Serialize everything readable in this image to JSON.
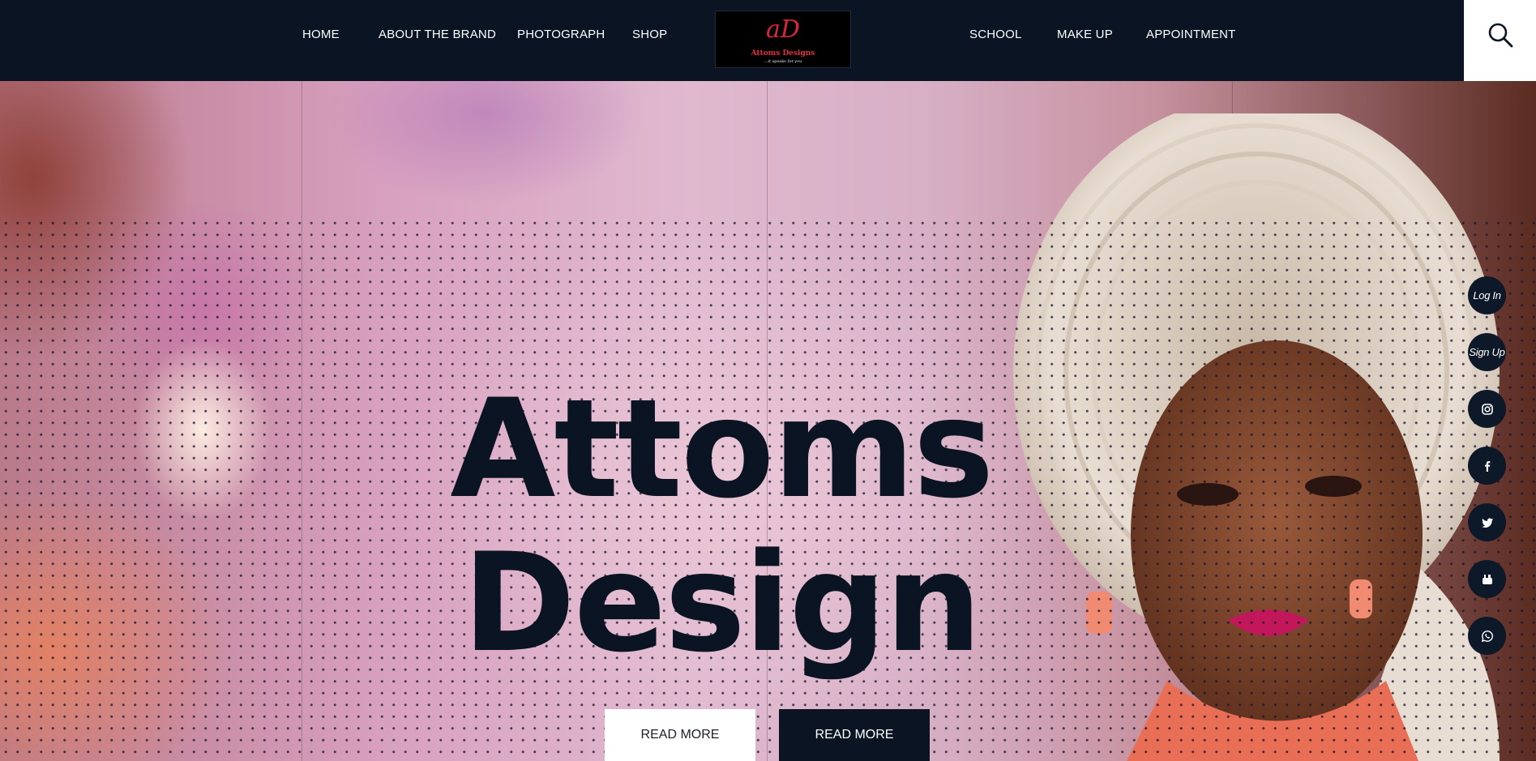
{
  "nav": {
    "left": [
      "HOME",
      "ABOUT THE BRAND",
      "PHOTOGRAPH",
      "SHOP"
    ],
    "right": [
      "SCHOOL",
      "MAKE UP",
      "APPOINTMENT"
    ]
  },
  "logo": {
    "mark": "aD",
    "name": "Attoms Designs",
    "tagline": "...it speaks for you"
  },
  "hero": {
    "title_line1": "Attoms",
    "title_line2": "Design",
    "button_primary": "READ MORE",
    "button_secondary": "READ MORE"
  },
  "side": {
    "login": "Log In",
    "signup": "Sign Up",
    "icons": [
      "instagram-icon",
      "facebook-icon",
      "twitter-icon",
      "youtube-icon",
      "whatsapp-icon"
    ]
  },
  "colors": {
    "navy": "#0b1422",
    "white": "#ffffff",
    "logo_red": "#d8273b"
  }
}
